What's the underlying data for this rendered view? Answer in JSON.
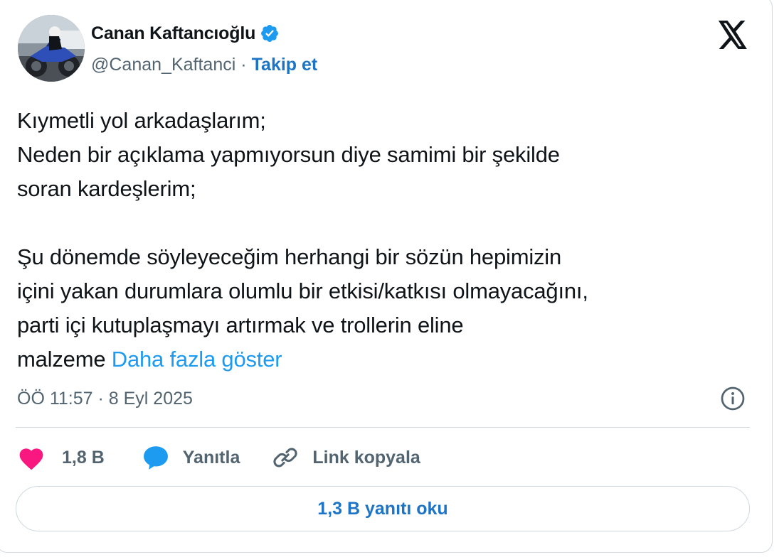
{
  "author": {
    "display_name": "Canan Kaftancıoğlu",
    "handle": "@Canan_Kaftanci",
    "separator": "·",
    "follow_label": "Takip et",
    "verified": true
  },
  "tweet": {
    "lines": [
      "Kıymetli yol arkadaşlarım;",
      "Neden bir açıklama yapmıyorsun diye samimi bir şekilde",
      "soran kardeşlerim;",
      "",
      "Şu dönemde söyleyeceğim herhangi bir sözün hepimizin",
      "içini yakan durumlara olumlu bir etkisi/katkısı olmayacağını,",
      "parti içi kutuplaşmayı artırmak ve trollerin eline",
      "malzeme"
    ],
    "show_more_label": "Daha fazla göster",
    "timestamp": "ÖÖ 11:57 · 8 Eyl 2025"
  },
  "actions": {
    "like_count": "1,8 B",
    "reply_label": "Yanıtla",
    "copy_link_label": "Link kopyala"
  },
  "read_replies_label": "1,3 B yanıtı oku",
  "icons": {
    "like": "heart-icon",
    "reply": "speech-bubble-icon",
    "copy_link": "link-icon",
    "info": "info-icon",
    "brand": "x-logo-icon",
    "verified": "verified-badge-icon"
  },
  "colors": {
    "accent": "#1d9bf0",
    "link_dark": "#1d74c5",
    "like": "#f91880",
    "text": "#0f1419",
    "secondary": "#536471",
    "border": "#cfd9de"
  }
}
